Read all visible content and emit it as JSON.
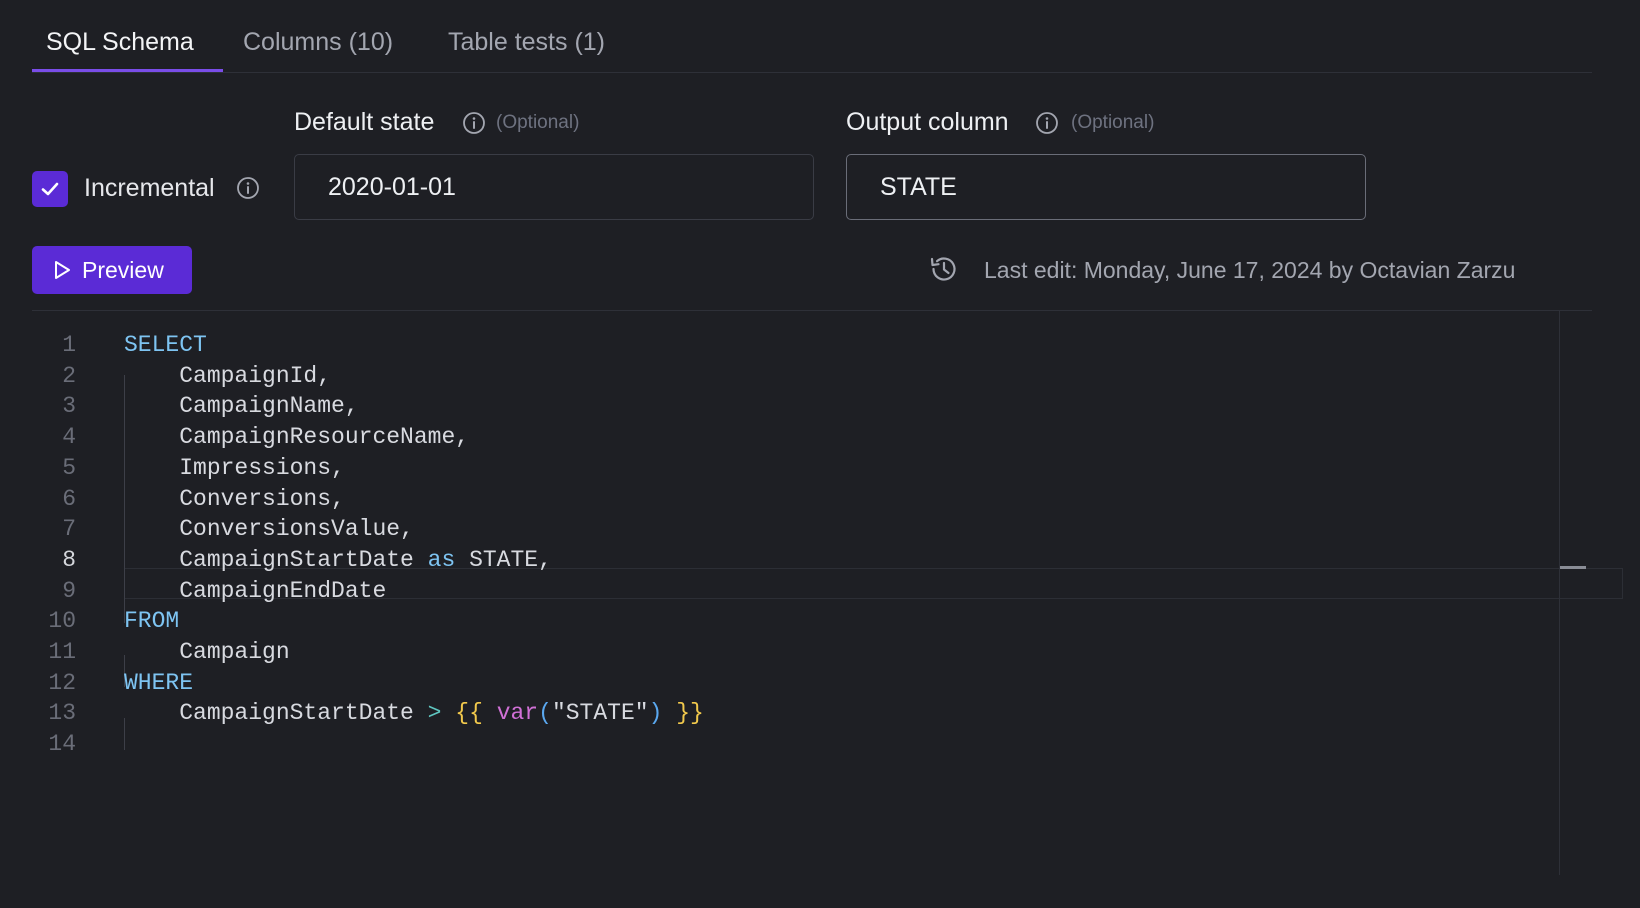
{
  "tabs": [
    {
      "label": "SQL Schema",
      "active": true
    },
    {
      "label": "Columns (10)",
      "active": false
    },
    {
      "label": "Table tests (1)",
      "active": false
    }
  ],
  "incremental": {
    "label": "Incremental",
    "checked": true
  },
  "default_state": {
    "label": "Default state",
    "optional": "(Optional)",
    "value": "2020-01-01"
  },
  "output_column": {
    "label": "Output column",
    "optional": "(Optional)",
    "value": "STATE"
  },
  "preview_button": {
    "label": "Preview"
  },
  "last_edit": {
    "text": "Last edit: Monday, June 17, 2024 by Octavian Zarzu"
  },
  "editor": {
    "current_line": 8,
    "line_numbers": [
      "1",
      "2",
      "3",
      "4",
      "5",
      "6",
      "7",
      "8",
      "9",
      "10",
      "11",
      "12",
      "13",
      "14"
    ],
    "lines": [
      [
        {
          "t": "SELECT",
          "c": "kw"
        }
      ],
      [
        {
          "t": "    CampaignId,",
          "c": ""
        }
      ],
      [
        {
          "t": "    CampaignName,",
          "c": ""
        }
      ],
      [
        {
          "t": "    CampaignResourceName,",
          "c": ""
        }
      ],
      [
        {
          "t": "    Impressions,",
          "c": ""
        }
      ],
      [
        {
          "t": "    Conversions,",
          "c": ""
        }
      ],
      [
        {
          "t": "    ConversionsValue,",
          "c": ""
        }
      ],
      [
        {
          "t": "    CampaignStartDate ",
          "c": ""
        },
        {
          "t": "as",
          "c": "kw"
        },
        {
          "t": " STATE,",
          "c": ""
        }
      ],
      [
        {
          "t": "    CampaignEndDate",
          "c": ""
        }
      ],
      [
        {
          "t": "FROM",
          "c": "kw"
        }
      ],
      [
        {
          "t": "    Campaign",
          "c": ""
        }
      ],
      [
        {
          "t": "WHERE",
          "c": "kw"
        }
      ],
      [
        {
          "t": "    CampaignStartDate ",
          "c": ""
        },
        {
          "t": ">",
          "c": "op"
        },
        {
          "t": " ",
          "c": ""
        },
        {
          "t": "{{",
          "c": "brace"
        },
        {
          "t": " ",
          "c": ""
        },
        {
          "t": "var",
          "c": "fn"
        },
        {
          "t": "(",
          "c": "paren"
        },
        {
          "t": "\"STATE\"",
          "c": "str"
        },
        {
          "t": ")",
          "c": "paren"
        },
        {
          "t": " ",
          "c": ""
        },
        {
          "t": "}}",
          "c": "brace"
        }
      ],
      []
    ]
  },
  "colors": {
    "accent": "#5b2bd6",
    "background": "#1e1f24",
    "keyword": "#7ec4f2",
    "template_brace": "#f2c94c",
    "function": "#d070d6"
  },
  "icons": {
    "checkbox": "check-icon",
    "info": "info-icon",
    "preview": "play-icon",
    "history": "history-icon"
  }
}
